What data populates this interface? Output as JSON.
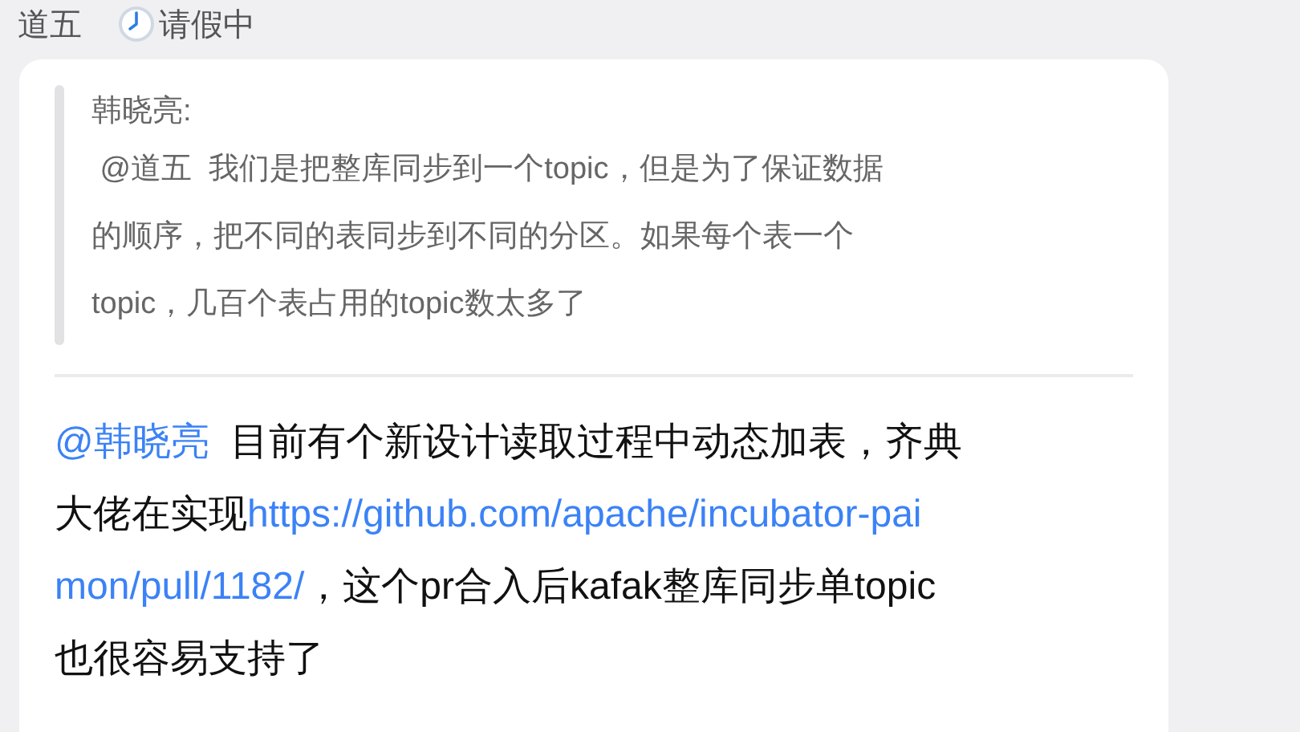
{
  "header": {
    "name": "道五",
    "status": "请假中"
  },
  "quote": {
    "author": "韩晓亮:",
    "lines": [
      [
        {
          "kind": "text",
          "text": " @道五  我们是把整库同步到一个topic，但是为了保证数据"
        }
      ],
      [
        {
          "kind": "text",
          "text": "的顺序，把不同的表同步到不同的分区。如果每个表一个"
        }
      ],
      [
        {
          "kind": "text",
          "text": "topic，几百个表占用的topic数太多了"
        }
      ]
    ]
  },
  "message": {
    "lines": [
      [
        {
          "kind": "mention",
          "text": "@韩晓亮"
        },
        {
          "kind": "text",
          "text": "  目前有个新设计读取过程中动态加表，齐典"
        }
      ],
      [
        {
          "kind": "text",
          "text": "大佬在实现"
        },
        {
          "kind": "link",
          "text": "https://github.com/apache/incubator-pai"
        }
      ],
      [
        {
          "kind": "link",
          "text": "mon/pull/1182/"
        },
        {
          "kind": "text",
          "text": "，这个pr合入后kafak整库同步单topic"
        }
      ],
      [
        {
          "kind": "text",
          "text": "也很容易支持了"
        }
      ]
    ]
  }
}
